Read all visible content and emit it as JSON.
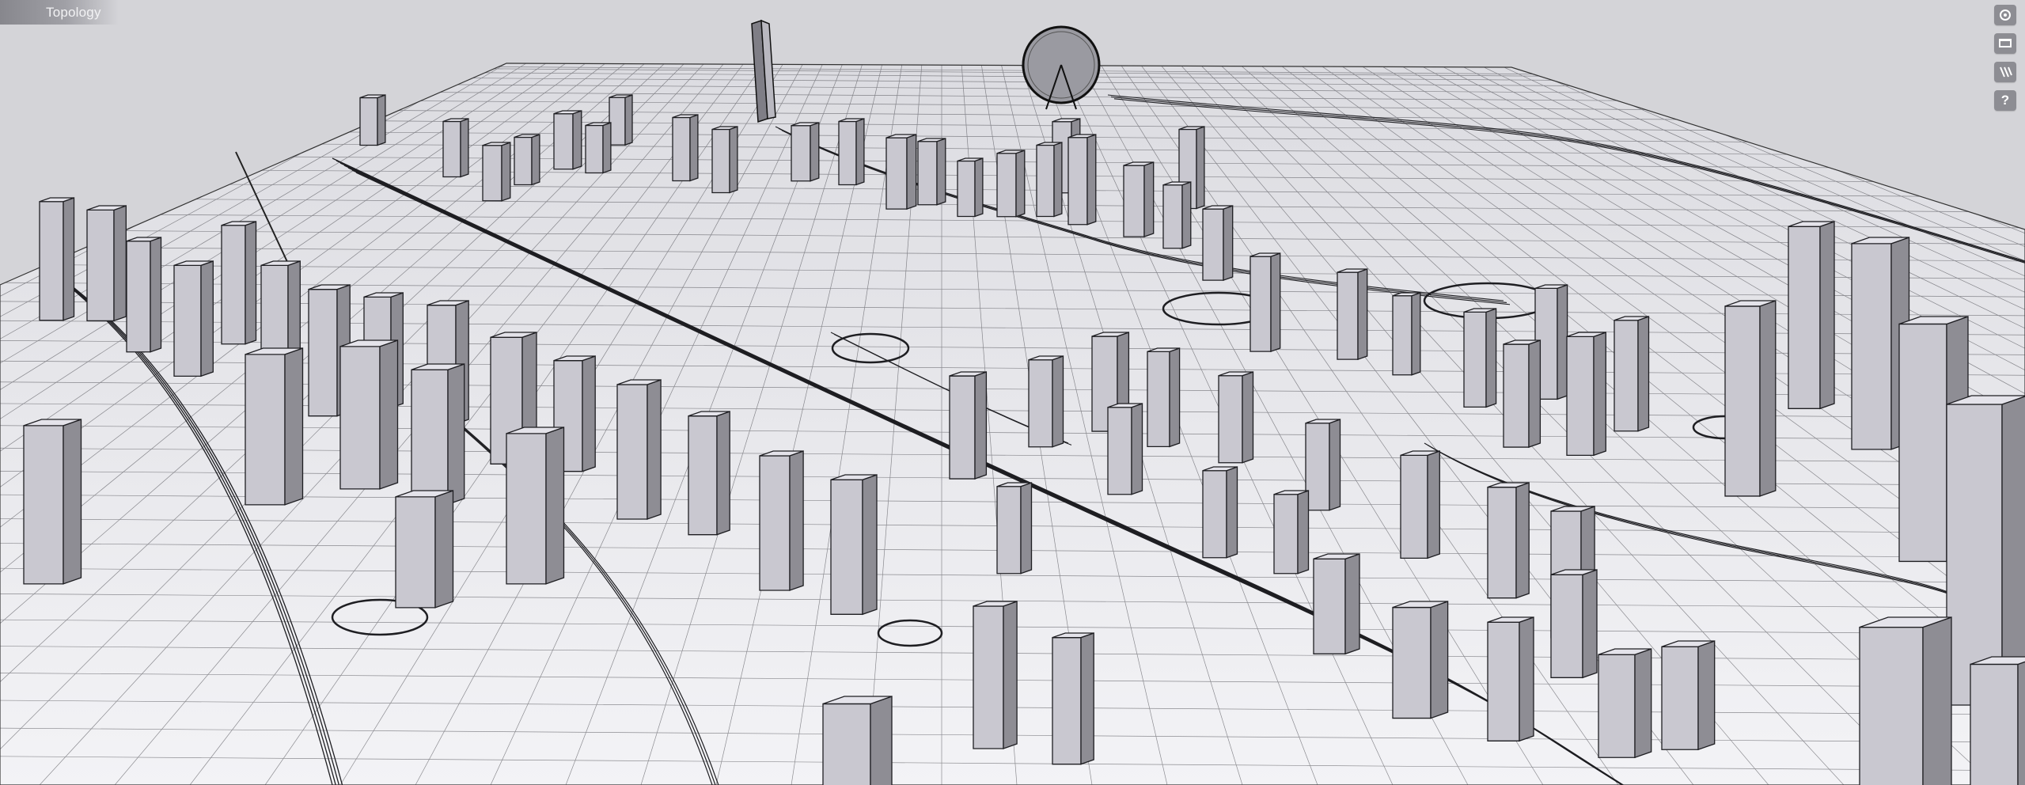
{
  "viewport": {
    "tab_label": "Topology"
  },
  "toolbar": {
    "buttons": [
      {
        "icon": "settings-icon"
      },
      {
        "icon": "monitor-icon"
      },
      {
        "icon": "layers-icon"
      },
      {
        "icon": "help-icon",
        "glyph": "?"
      }
    ]
  },
  "colors": {
    "background": "#d4d4d8",
    "ground": "#e9e9ee",
    "building_light": "#c9c8d0",
    "building_dark": "#8e8d94",
    "edge": "#1e1e22",
    "toolbar_button": "#8d8d93"
  }
}
